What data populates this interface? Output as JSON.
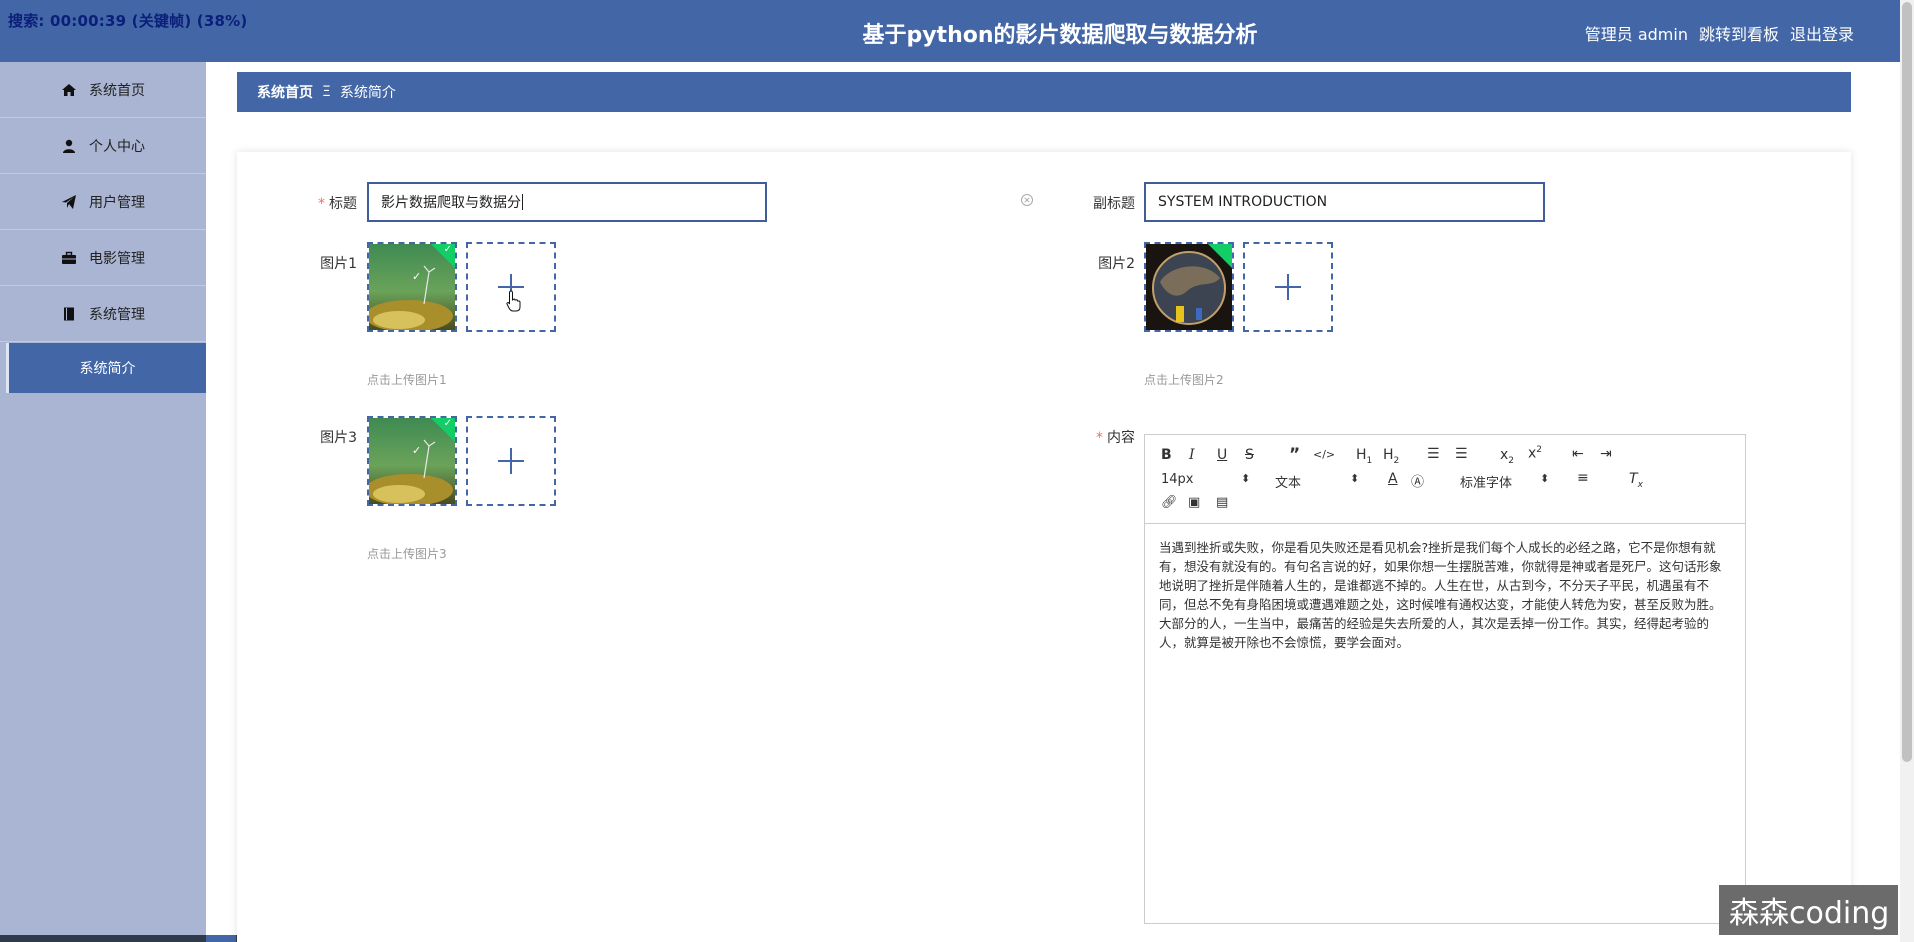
{
  "header": {
    "recording": "搜索: 00:00:39 (关键帧) (38%)",
    "title": "基于python的影片数据爬取与数据分析",
    "admin": "管理员 admin",
    "dashboard": "跳转到看板",
    "logout": "退出登录"
  },
  "sidebar": {
    "items": [
      {
        "label": "系统首页",
        "icon": "home-icon"
      },
      {
        "label": "个人中心",
        "icon": "user-icon"
      },
      {
        "label": "用户管理",
        "icon": "paper-plane-icon"
      },
      {
        "label": "电影管理",
        "icon": "briefcase-icon"
      },
      {
        "label": "系统管理",
        "icon": "book-icon"
      }
    ],
    "sub_active": "系统简介"
  },
  "breadcrumb": {
    "home": "系统首页",
    "sep": "Ξ",
    "current": "系统简介"
  },
  "form": {
    "title_label": "标题",
    "title_value": "影片数据爬取与数据分",
    "subtitle_label": "副标题",
    "subtitle_value": "SYSTEM INTRODUCTION",
    "img1_label": "图片1",
    "img1_hint": "点击上传图片1",
    "img2_label": "图片2",
    "img2_hint": "点击上传图片2",
    "img3_label": "图片3",
    "img3_hint": "点击上传图片3",
    "content_label": "内容"
  },
  "editor": {
    "font_size": "14px",
    "text_type": "文本",
    "font_family": "标准字体",
    "content": "当遇到挫折或失败，你是看见失败还是看见机会?挫折是我们每个人成长的必经之路，它不是你想有就有，想没有就没有的。有句名言说的好，如果你想一生摆脱苦难，你就得是神或者是死尸。这句话形象地说明了挫折是伴随着人生的，是谁都逃不掉的。人生在世，从古到今，不分天子平民，机遇虽有不同，但总不免有身陷困境或遭遇难题之处，这时候唯有通权达变，才能使人转危为安，甚至反败为胜。大部分的人，一生当中，最痛苦的经验是失去所爱的人，其次是丢掉一份工作。其实，经得起考验的人，就算是被开除也不会惊慌，要学会面对。"
  },
  "watermark": "森森coding",
  "colors": {
    "primary": "#4366a6",
    "sidebar": "#a9b5d3",
    "success": "#13ce66",
    "required": "#f56c6c"
  }
}
